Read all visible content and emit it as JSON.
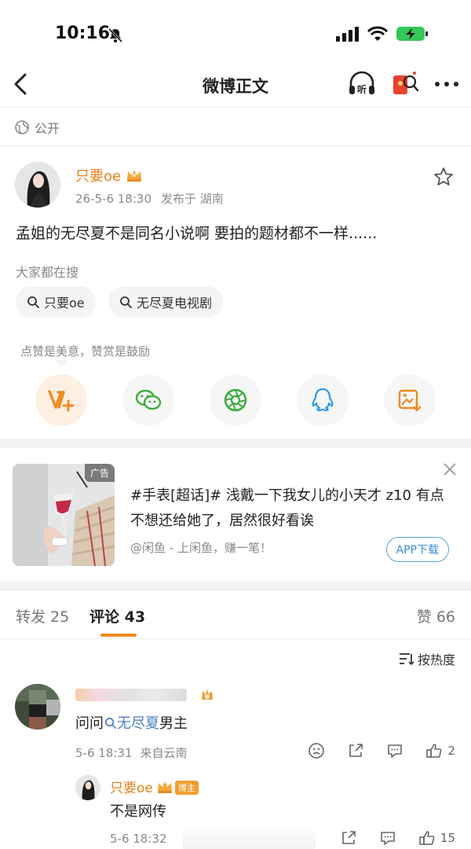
{
  "status_bar": {
    "time": "10:16"
  },
  "nav": {
    "title": "微博正文"
  },
  "visibility": {
    "label": "公开"
  },
  "post": {
    "author": "只要oe",
    "date": "26-5-6 18:30",
    "location": "发布于 湖南",
    "text": "孟姐的无尽夏不是同名小说啊 要拍的题材都不一样......"
  },
  "search": {
    "label": "大家都在搜",
    "chips": [
      "只要oe",
      "无尽夏电视剧"
    ]
  },
  "reward_hint": "点赞是美意，赞赏是鼓励",
  "share_icons": [
    "weibo-reward-icon",
    "wechat-icon",
    "moments-icon",
    "qq-icon",
    "save-image-icon"
  ],
  "ad": {
    "tag": "广告",
    "title": "#手表[超话]# 浅戴一下我女儿的小天才 z10 有点不想还给她了，居然很好看诶",
    "source": "@闲鱼 - 上闲鱼，赚一笔！",
    "button": "APP下载"
  },
  "tabs": [
    {
      "label": "转发 25"
    },
    {
      "label": "评论 43"
    },
    {
      "label": "赞 66"
    }
  ],
  "sort": {
    "label": "按热度"
  },
  "comments": [
    {
      "text_prefix": "问问",
      "link": "无尽夏",
      "text_suffix": "男主",
      "time": "5-6 18:31",
      "source": "来自云南",
      "likes": "2"
    },
    {
      "author": "只要oe",
      "tag": "博主",
      "text": "不是网传",
      "time": "5-6 18:32",
      "likes": "15"
    }
  ],
  "colors": {
    "accent": "#f08a22",
    "author": "#e8821a",
    "link": "#4a7fbf"
  }
}
